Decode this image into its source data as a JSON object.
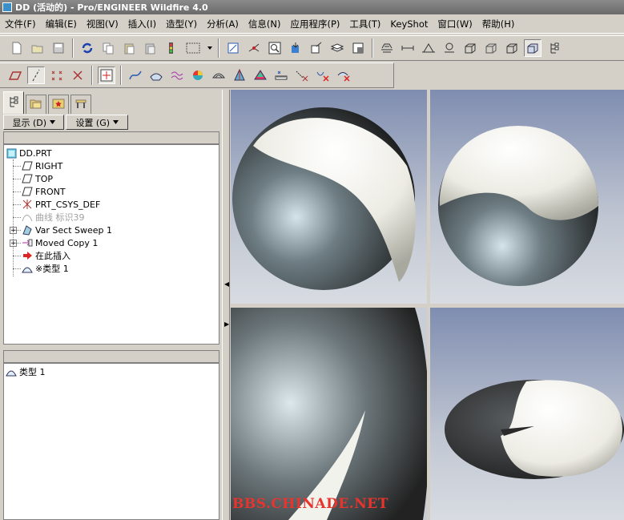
{
  "window": {
    "title": "DD (活动的) - Pro/ENGINEER Wildfire 4.0"
  },
  "menu": [
    {
      "label": "文件(F)"
    },
    {
      "label": "编辑(E)"
    },
    {
      "label": "视图(V)"
    },
    {
      "label": "插入(I)"
    },
    {
      "label": "造型(Y)"
    },
    {
      "label": "分析(A)"
    },
    {
      "label": "信息(N)"
    },
    {
      "label": "应用程序(P)"
    },
    {
      "label": "工具(T)"
    },
    {
      "label": "KeyShot"
    },
    {
      "label": "窗口(W)"
    },
    {
      "label": "帮助(H)"
    }
  ],
  "nav": {
    "show_label": "显示 (D)",
    "settings_label": "设置 (G)"
  },
  "tree": {
    "root": "DD.PRT",
    "items": [
      {
        "label": "RIGHT",
        "icon": "datum-plane-icon"
      },
      {
        "label": "TOP",
        "icon": "datum-plane-icon"
      },
      {
        "label": "FRONT",
        "icon": "datum-plane-icon"
      },
      {
        "label": "PRT_CSYS_DEF",
        "icon": "csys-icon"
      },
      {
        "label": "曲线 标识39",
        "icon": "curve-icon",
        "dim": true
      },
      {
        "label": "Var Sect Sweep 1",
        "icon": "sweep-icon",
        "expandable": true
      },
      {
        "label": "Moved Copy 1",
        "icon": "moved-copy-icon",
        "expandable": true
      },
      {
        "label": "在此插入",
        "icon": "insert-here-icon"
      },
      {
        "label": "※类型 1",
        "icon": "style-feature-icon"
      }
    ]
  },
  "lower_panel": {
    "item": "类型 1"
  },
  "watermark": "BBS.CHINADE.NET",
  "colors": {
    "tree_selected": "#0a246a",
    "watermark": "#e8342e"
  }
}
